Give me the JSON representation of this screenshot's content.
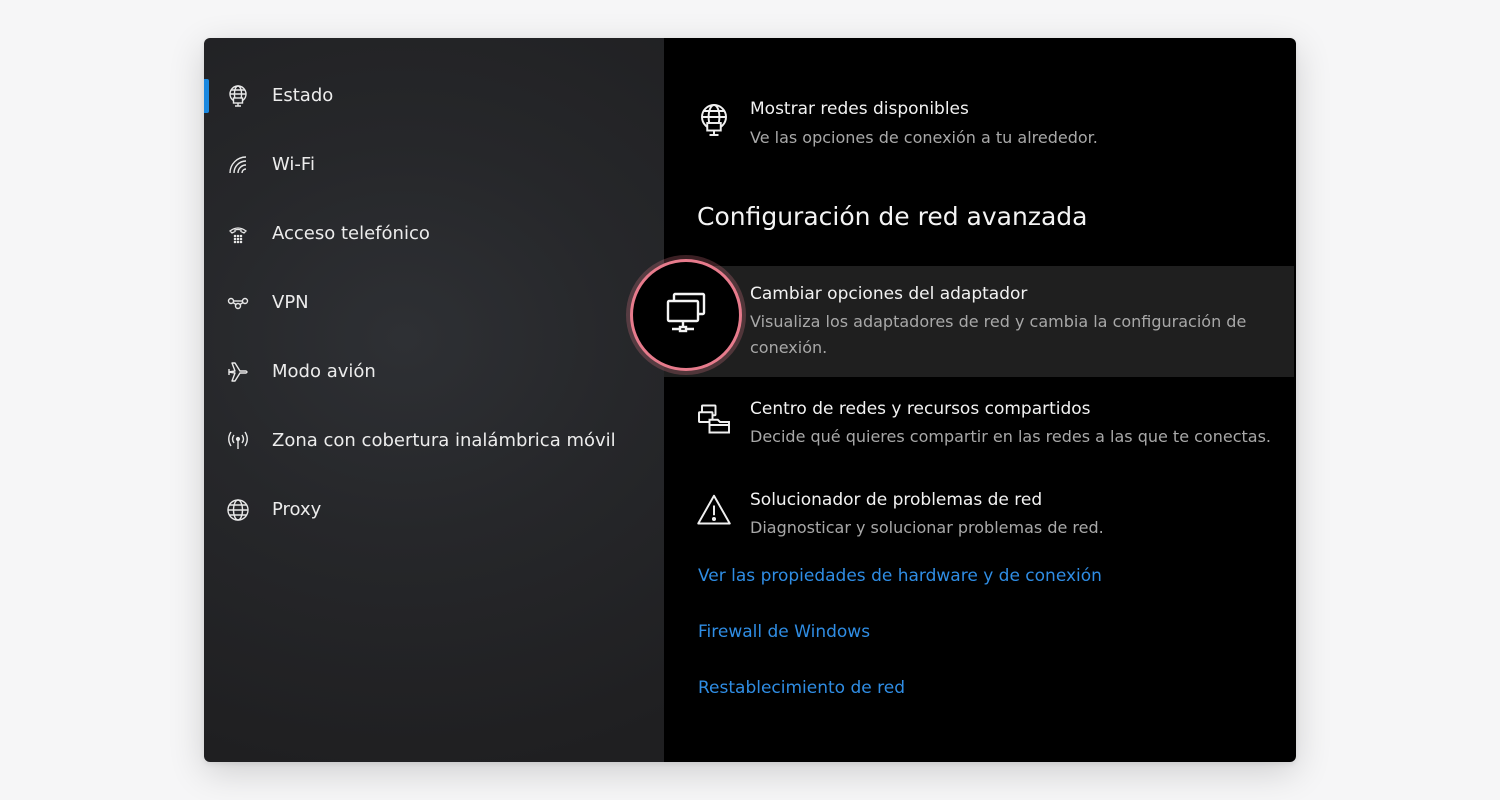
{
  "sidebar": {
    "items": [
      {
        "label": "Estado",
        "icon": "globe-network-icon",
        "active": true
      },
      {
        "label": "Wi-Fi",
        "icon": "wifi-icon"
      },
      {
        "label": "Acceso telefónico",
        "icon": "dialup-phone-icon"
      },
      {
        "label": "VPN",
        "icon": "vpn-icon"
      },
      {
        "label": "Modo avión",
        "icon": "airplane-icon"
      },
      {
        "label": "Zona con cobertura inalámbrica móvil",
        "icon": "mobile-hotspot-icon"
      },
      {
        "label": "Proxy",
        "icon": "globe-icon"
      }
    ],
    "accent_color": "#1a88e0"
  },
  "main": {
    "available_networks": {
      "title": "Mostrar redes disponibles",
      "description": "Ve las opciones de conexión a tu alrededor.",
      "icon": "globe-network-icon"
    },
    "advanced_title": "Configuración de red avanzada",
    "options": [
      {
        "title": "Cambiar opciones del adaptador",
        "description": "Visualiza los adaptadores de red y cambia la configuración de conexión.",
        "icon": "network-adapter-icon",
        "highlighted": true
      },
      {
        "title": "Centro de redes y recursos compartidos",
        "description": "Decide qué quieres compartir en las redes a las que te conectas.",
        "icon": "network-sharing-icon"
      },
      {
        "title": "Solucionador de problemas de red",
        "description": "Diagnosticar y solucionar problemas de red.",
        "icon": "warning-icon"
      }
    ],
    "links": [
      {
        "label": "Ver las propiedades de hardware y de conexión"
      },
      {
        "label": "Firewall de Windows"
      },
      {
        "label": "Restablecimiento de red"
      }
    ],
    "link_color": "#2f8de4"
  },
  "callout": {
    "icon": "network-adapter-icon",
    "ring_color": "#e77b8c"
  }
}
